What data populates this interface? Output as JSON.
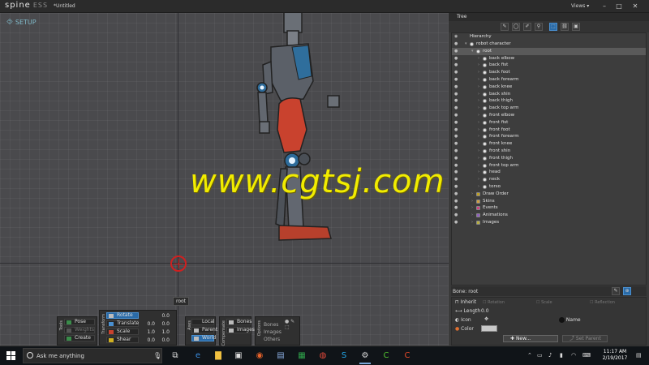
{
  "titlebar": {
    "logo": "spine",
    "edition": "ESS",
    "document": "*Untitled",
    "views": "Views"
  },
  "viewport": {
    "mode": "SETUP",
    "root_tag": "root",
    "watermark": "www.cgtsj.com"
  },
  "tools": {
    "tools_label": "Tools",
    "transform_label": "Transform",
    "axes_label": "Axes",
    "compensate_label": "Compensate",
    "options_label": "Options",
    "pose": "Pose",
    "weights": "Weights",
    "create": "Create",
    "rotate": "Rotate",
    "translate": "Translate",
    "scale": "Scale",
    "shear": "Shear",
    "rotate_val": "0.0",
    "translate_x": "0.0",
    "translate_y": "0.0",
    "scale_x": "1.0",
    "scale_y": "1.0",
    "shear_x": "0.0",
    "shear_y": "0.0",
    "local": "Local",
    "parent": "Parent",
    "world": "World",
    "bones": "Bones",
    "images": "Images",
    "opt_bones": "Bones",
    "opt_images": "Images",
    "opt_others": "Others"
  },
  "tree": {
    "title": "Tree",
    "hierarchy_label": "Hierarchy",
    "rows": [
      {
        "label": "robot character",
        "indent": 0
      },
      {
        "label": "root",
        "indent": 1
      },
      {
        "label": "back elbow",
        "indent": 2
      },
      {
        "label": "back fist",
        "indent": 2
      },
      {
        "label": "back foot",
        "indent": 2
      },
      {
        "label": "back forearm",
        "indent": 2
      },
      {
        "label": "back knee",
        "indent": 2
      },
      {
        "label": "back shin",
        "indent": 2
      },
      {
        "label": "back thigh",
        "indent": 2
      },
      {
        "label": "back top arm",
        "indent": 2
      },
      {
        "label": "front elbow",
        "indent": 2
      },
      {
        "label": "front fist",
        "indent": 2
      },
      {
        "label": "front foot",
        "indent": 2
      },
      {
        "label": "front forearm",
        "indent": 2
      },
      {
        "label": "front knee",
        "indent": 2
      },
      {
        "label": "front shin",
        "indent": 2
      },
      {
        "label": "front thigh",
        "indent": 2
      },
      {
        "label": "front top arm",
        "indent": 2
      },
      {
        "label": "head",
        "indent": 2
      },
      {
        "label": "neck",
        "indent": 2
      },
      {
        "label": "torso",
        "indent": 2
      },
      {
        "label": "Draw Order",
        "indent": 1
      },
      {
        "label": "Skins",
        "indent": 1
      },
      {
        "label": "Events",
        "indent": 1
      },
      {
        "label": "Animations",
        "indent": 1
      },
      {
        "label": "Images",
        "indent": 1
      }
    ]
  },
  "bone": {
    "header": "Bone: root",
    "inherit": "Inherit",
    "rotation": "Rotation",
    "scale": "Scale",
    "reflection": "Reflection",
    "length_label": "Length",
    "length": "0.0",
    "icon_label": "Icon",
    "name_label": "Name",
    "color_label": "Color",
    "new": "New...",
    "set_parent": "Set Parent"
  },
  "taskbar": {
    "search_placeholder": "Ask me anything",
    "time": "11:17 AM",
    "date": "2/19/2017"
  },
  "colors": {
    "accent": "#2a6ba8",
    "root_marker": "#d02020",
    "watermark": "#f1ec00"
  }
}
